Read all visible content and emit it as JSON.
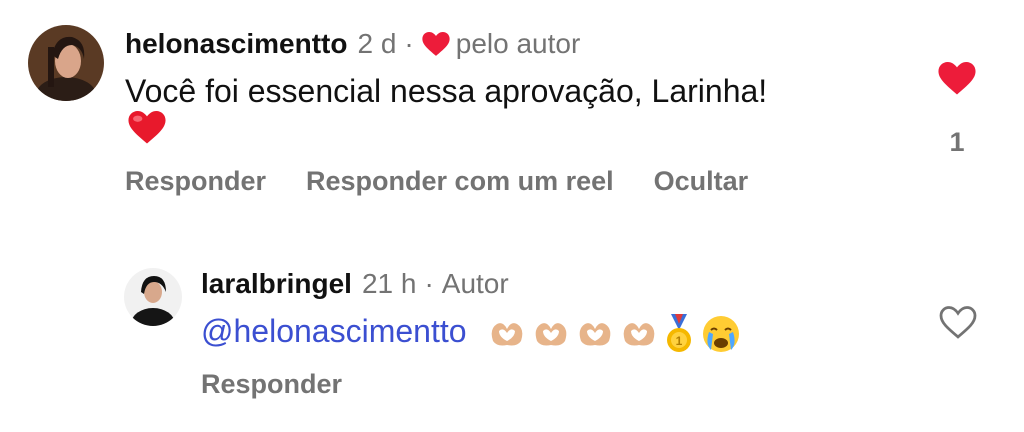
{
  "comments": [
    {
      "username": "helonascimentto",
      "time": "2 d",
      "separator": "·",
      "byline": "pelo autor",
      "text": "Você foi essencial nessa aprovação, Larinha!",
      "like_count": "1",
      "actions": [
        "Responder",
        "Responder com um reel",
        "Ocultar"
      ],
      "liked": true,
      "heart_color": "#ed1c3a"
    },
    {
      "username": "laralbringel",
      "time": "21 h",
      "separator": "·",
      "byline": "Autor",
      "mention": "@helonascimentto",
      "actions": [
        "Responder"
      ],
      "liked": false
    }
  ],
  "colors": {
    "text": "#111111",
    "secondary": "#737373",
    "mention": "#3b4fd1",
    "heart": "#ed1c3a"
  }
}
